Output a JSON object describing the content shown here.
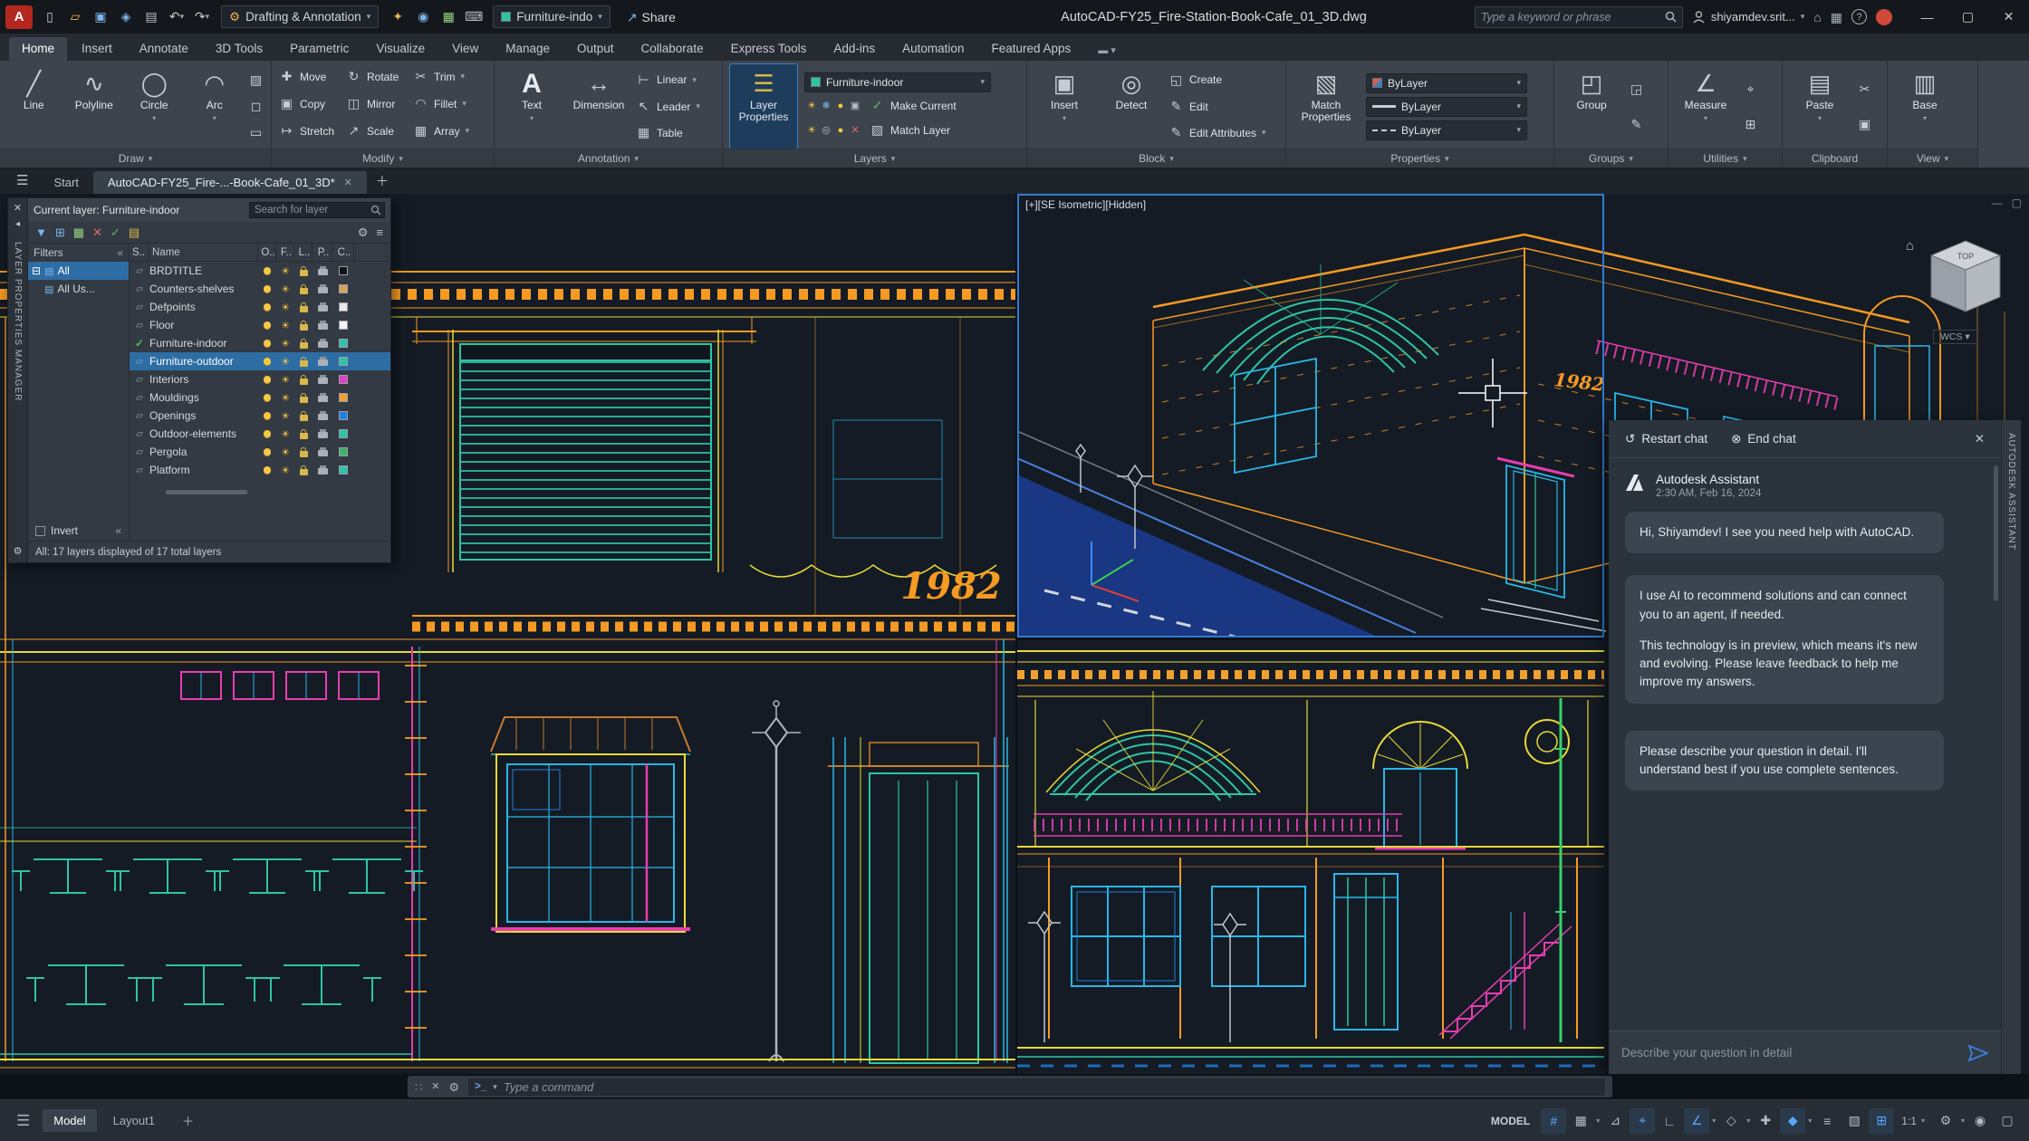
{
  "titlebar": {
    "workspace": "Drafting & Annotation",
    "layer_pill": "Furniture-indo",
    "share": "Share",
    "doc_title": "AutoCAD-FY25_Fire-Station-Book-Cafe_01_3D.dwg",
    "search_placeholder": "Type a keyword or phrase",
    "user": "shiyamdev.srit..."
  },
  "tabs": {
    "items": [
      "Home",
      "Insert",
      "Annotate",
      "3D Tools",
      "Parametric",
      "Visualize",
      "View",
      "Manage",
      "Output",
      "Collaborate",
      "Express Tools",
      "Add-ins",
      "Automation",
      "Featured Apps"
    ]
  },
  "ribbon": {
    "draw": {
      "label": "Draw",
      "b0": "Line",
      "b1": "Polyline",
      "b2": "Circle",
      "b3": "Arc"
    },
    "modify": {
      "label": "Modify",
      "b0": "Move",
      "b1": "Rotate",
      "b2": "Trim",
      "b3": "Copy",
      "b4": "Mirror",
      "b5": "Fillet",
      "b6": "Stretch",
      "b7": "Scale",
      "b8": "Array"
    },
    "annotation": {
      "label": "Annotation",
      "text": "Text",
      "dimension": "Dimension",
      "linear": "Linear",
      "leader": "Leader",
      "table": "Table"
    },
    "layers": {
      "label": "Layers",
      "layer_properties": "Layer Properties",
      "current_layer": "Furniture-indoor",
      "make_current": "Make Current",
      "match_layer": "Match Layer"
    },
    "block": {
      "label": "Block",
      "insert": "Insert",
      "detect": "Detect",
      "create": "Create",
      "edit": "Edit",
      "edit_attributes": "Edit Attributes"
    },
    "properties": {
      "label": "Properties",
      "match_properties": "Match Properties",
      "bylayer": "ByLayer"
    },
    "groups": {
      "label": "Groups",
      "group": "Group"
    },
    "utilities": {
      "label": "Utilities",
      "measure": "Measure"
    },
    "clipboard": {
      "label": "Clipboard",
      "paste": "Paste"
    },
    "view": {
      "label": "View",
      "base": "Base"
    }
  },
  "doc_tabs": {
    "start": "Start",
    "active": "AutoCAD-FY25_Fire-...-Book-Cafe_01_3D*"
  },
  "palette": {
    "spine": "LAYER PROPERTIES MANAGER",
    "current": "Current layer: Furniture-indoor",
    "search_placeholder": "Search for layer",
    "filters": "Filters",
    "tree0": "All",
    "tree1": "All Us...",
    "col_s": "S..",
    "col_name": "Name",
    "col_o": "O..",
    "col_f": "F..",
    "col_l": "L..",
    "col_p": "P..",
    "col_c": "C..",
    "rows": [
      {
        "name": "BRDTITLE",
        "color": "#101418"
      },
      {
        "name": "Counters-shelves",
        "color": "#d8a45a"
      },
      {
        "name": "Defpoints",
        "color": "#e8e8e8"
      },
      {
        "name": "Floor",
        "color": "#f2f2f2"
      },
      {
        "name": "Furniture-indoor",
        "color": "#2ec4a5"
      },
      {
        "name": "Furniture-outdoor",
        "color": "#2ec4a5"
      },
      {
        "name": "Interiors",
        "color": "#e040c8"
      },
      {
        "name": "Mouldings",
        "color": "#f0a030"
      },
      {
        "name": "Openings",
        "color": "#2080e0"
      },
      {
        "name": "Outdoor-elements",
        "color": "#2ec4a5"
      },
      {
        "name": "Pergola",
        "color": "#3db36b"
      },
      {
        "name": "Platform",
        "color": "#2ec4a5"
      }
    ],
    "invert": "Invert",
    "status": "All: 17 layers displayed of 17 total layers"
  },
  "canvas": {
    "viewport_label": "[+][SE Isometric][Hidden]",
    "wcs": "WCS",
    "sign": "1982",
    "cube_top": "TOP"
  },
  "chat": {
    "spine": "AUTODESK ASSISTANT",
    "restart": "Restart chat",
    "end": "End chat",
    "name": "Autodesk Assistant",
    "time": "2:30 AM, Feb 16, 2024",
    "m0": "Hi, Shiyamdev! I see you need help with AutoCAD.",
    "m1": "I use AI to recommend solutions and can connect you to an agent, if needed.",
    "m2": "This technology is in preview, which means it's new and evolving. Please leave feedback to help me improve my answers.",
    "m3": "Please describe your question in detail. I'll understand best if you use complete sentences.",
    "input_placeholder": "Describe your question in detail"
  },
  "command": {
    "placeholder": "Type a command"
  },
  "statusbar": {
    "model_tab": "Model",
    "layout_tab": "Layout1",
    "model_space": "MODEL",
    "scale": "1:1",
    "icons": [
      {
        "name": "grid-display",
        "glyph": "#",
        "active": true
      },
      {
        "name": "snap-mode",
        "glyph": "▦",
        "active": false
      },
      {
        "name": "infer-constraints",
        "glyph": "⊿",
        "active": false
      },
      {
        "name": "dynamic-input",
        "glyph": "⌖",
        "active": true
      },
      {
        "name": "ortho-mode",
        "glyph": "∟",
        "active": false
      },
      {
        "name": "polar-tracking",
        "glyph": "∠",
        "active": true
      },
      {
        "name": "isometric-drafting",
        "glyph": "◇",
        "active": false
      },
      {
        "name": "object-snap-tracking",
        "glyph": "✚",
        "active": false
      },
      {
        "name": "object-snap",
        "glyph": "◆",
        "active": true
      },
      {
        "name": "lineweight",
        "glyph": "≡",
        "active": false
      },
      {
        "name": "transparency",
        "glyph": "▨",
        "active": false
      },
      {
        "name": "selection-cycling",
        "glyph": "⊞",
        "active": true
      },
      {
        "name": "workspace-switching",
        "glyph": "⚙",
        "active": false
      },
      {
        "name": "annotation-monitor",
        "glyph": "◉",
        "active": false
      },
      {
        "name": "clean-screen",
        "glyph": "▢",
        "active": false
      }
    ]
  },
  "colors": {
    "accent_blue": "#2e7bd2",
    "teal": "#2ec4a5",
    "orange": "#f59a23",
    "yellow": "#e8d93a",
    "cyan": "#29b6e8",
    "magenta": "#e83db0",
    "street_blue": "#1e4fd0",
    "selection": "#2e6da4"
  }
}
